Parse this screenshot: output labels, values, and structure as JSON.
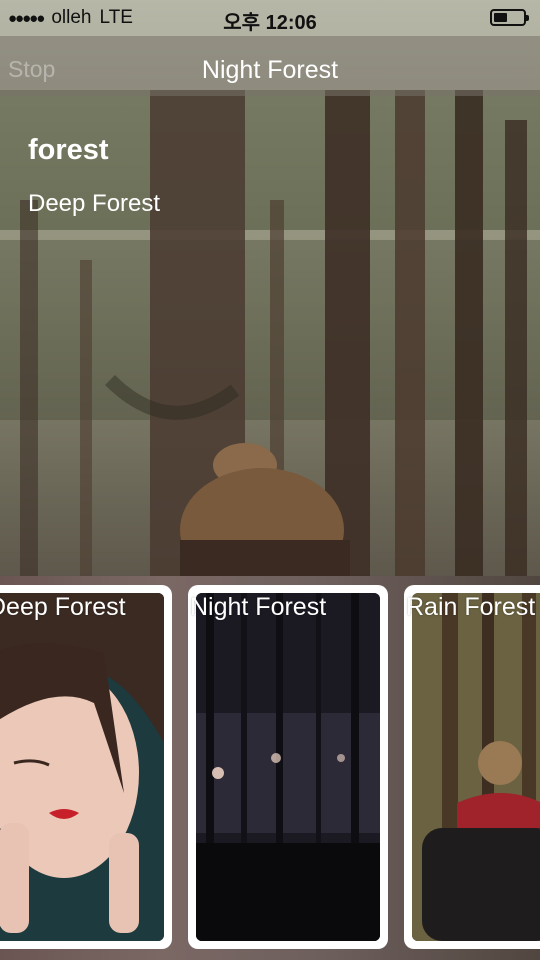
{
  "status_bar": {
    "carrier": "olleh",
    "network": "LTE",
    "time": "오후 12:06",
    "battery_level": 0.45
  },
  "nav": {
    "left_button": "Stop",
    "title": "Night Forest"
  },
  "hero": {
    "title": "forest",
    "subtitle": "Deep Forest"
  },
  "cards": [
    {
      "label": "Deep Forest"
    },
    {
      "label": "Night Forest"
    },
    {
      "label": "Rain Forest"
    }
  ]
}
